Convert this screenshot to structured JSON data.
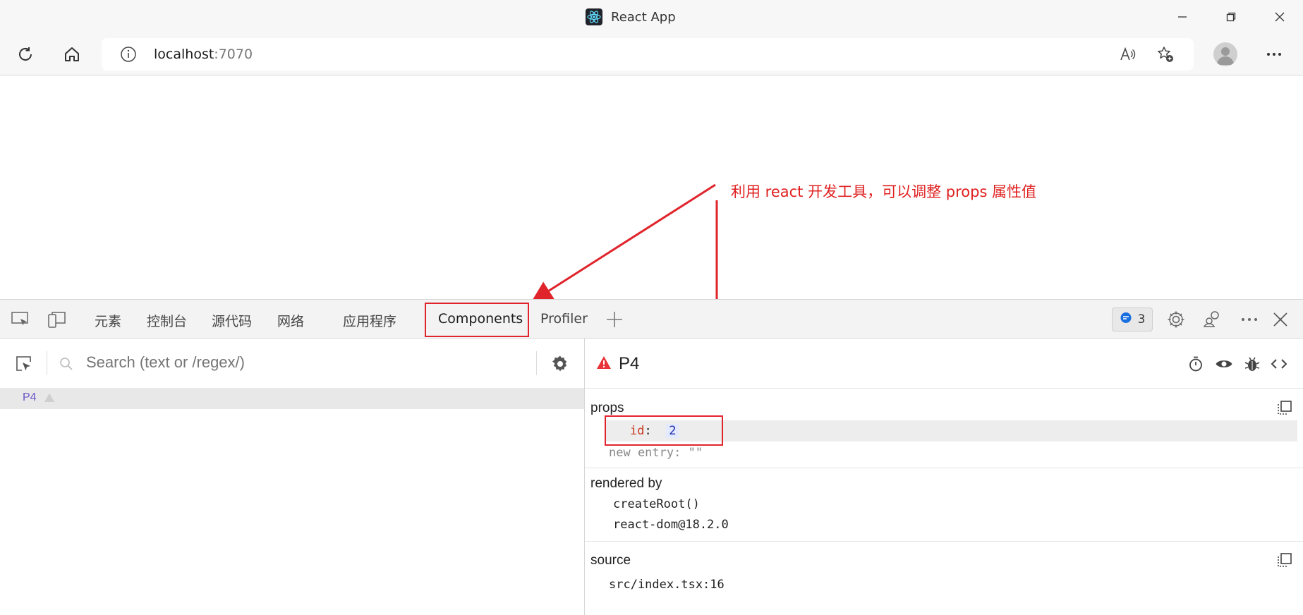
{
  "window": {
    "title": "React App"
  },
  "browser": {
    "url_host": "localhost",
    "url_port": ":7070"
  },
  "annotation": {
    "text": "利用 react 开发工具，可以调整 props 属性值"
  },
  "devtools": {
    "tabs": [
      "元素",
      "控制台",
      "源代码",
      "网络",
      "应用程序",
      "Components",
      "Profiler"
    ],
    "active_tab": "Components",
    "issues_count": "3"
  },
  "components_panel": {
    "search_placeholder": "Search (text or /regex/)",
    "tree": [
      {
        "label": "P4",
        "selected": true,
        "warning": true
      }
    ]
  },
  "inspector": {
    "component_name": "P4",
    "props_label": "props",
    "props": [
      {
        "key": "id",
        "value": "2",
        "editing": true
      },
      {
        "key": "new entry",
        "value": "\"\""
      }
    ],
    "rendered_by_label": "rendered by",
    "rendered_by": [
      "createRoot()",
      "react-dom@18.2.0"
    ],
    "source_label": "source",
    "source": "src/index.tsx:16"
  },
  "colors": {
    "annotation": "#e02020",
    "prop_key": "#c7381b",
    "tree_item": "#6a55c7",
    "warning": "#e8333a"
  }
}
